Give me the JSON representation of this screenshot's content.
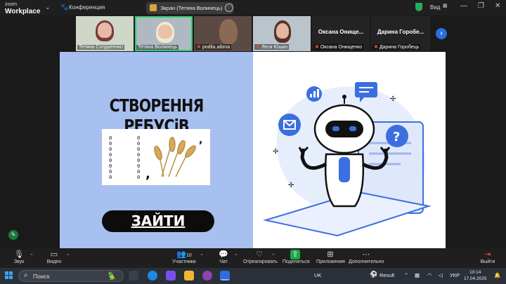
{
  "app": {
    "logo_top": "zoom",
    "logo_bottom": "Workplace",
    "conference_label": "Конференция"
  },
  "screen_share": {
    "label": "Экран (Тетяна Волинець)"
  },
  "top_right": {
    "view_label": "Вид"
  },
  "participants": [
    {
      "name": "Тетяна Солдатенко",
      "muted": false
    },
    {
      "name": "Тетяна Волинець",
      "muted": false
    },
    {
      "name": "podila.aibina",
      "muted": true
    },
    {
      "name": "Леся Юшко",
      "muted": true
    },
    {
      "name": "Оксана Онищенко",
      "display": "Оксана  Онище...",
      "muted": true
    },
    {
      "name": "Дарина Горобець",
      "display": "Дарина  Горобе...",
      "muted": true
    }
  ],
  "slide": {
    "title": "СТВОРЕННЯ РЕБУСіВ",
    "button": "ЗАЙТИ",
    "rebus_text": "0\n0\n0\n0\n0\n0\n0\n0"
  },
  "toolbar": {
    "audio": "Звук",
    "video": "Видео",
    "participants": "Участники",
    "participants_count": "10",
    "chat": "Чат",
    "react": "Отреагировать",
    "share": "Поделиться",
    "apps": "Приложения",
    "more": "Дополнительно",
    "leave": "Выйти"
  },
  "taskbar": {
    "search_placeholder": "Поиск",
    "lang_indicator": "UK",
    "result_label": "Result",
    "keyboard_lang": "УКР",
    "time": "10:14",
    "date": "17.04.2025"
  },
  "colors": {
    "slide_left_bg": "#a8c0f0",
    "accent_blue": "#2b6fe0",
    "share_green": "#1aa84c",
    "leave_red": "#e74c3c"
  }
}
